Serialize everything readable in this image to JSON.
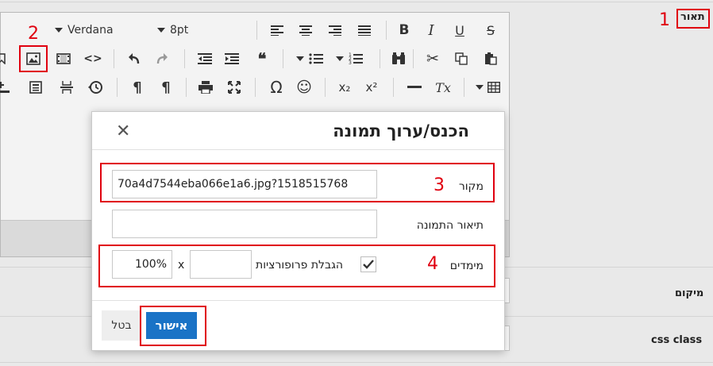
{
  "form": {
    "description_label": "תאור",
    "location_label": "מיקום",
    "css_class_label": "css class"
  },
  "toolbar": {
    "font_name": "Verdana",
    "font_size": "8pt",
    "bold_glyph": "B",
    "italic_glyph": "I",
    "underline_glyph": "U",
    "strike_glyph": "S",
    "source_glyph": "<>",
    "quote_glyph": "66",
    "omega_glyph": "Ω",
    "emoji_glyph": "☺",
    "sub_glyph": "x₂",
    "sup_glyph": "x²",
    "rtl_para_glyph": "¶",
    "ltr_para_glyph": "¶",
    "clear_format_glyph": "Tx"
  },
  "dialog": {
    "title": "הכנס/ערוך תמונה",
    "close_glyph": "✕",
    "source_label": "מקור",
    "source_value": "70a4d7544eba066e1a6.jpg?1518515768",
    "alt_label": "תיאור התמונה",
    "alt_value": "",
    "dimensions_label": "מימדים",
    "width_value": "100%",
    "times_sign": "x",
    "height_value": "",
    "constrain_label": "הגבלת פרופורציות",
    "ok_label": "אישור",
    "cancel_label": "בטל"
  },
  "annotations": {
    "n1": "1",
    "n2": "2",
    "n3": "3",
    "n4": "4",
    "color": "#e0000f"
  }
}
